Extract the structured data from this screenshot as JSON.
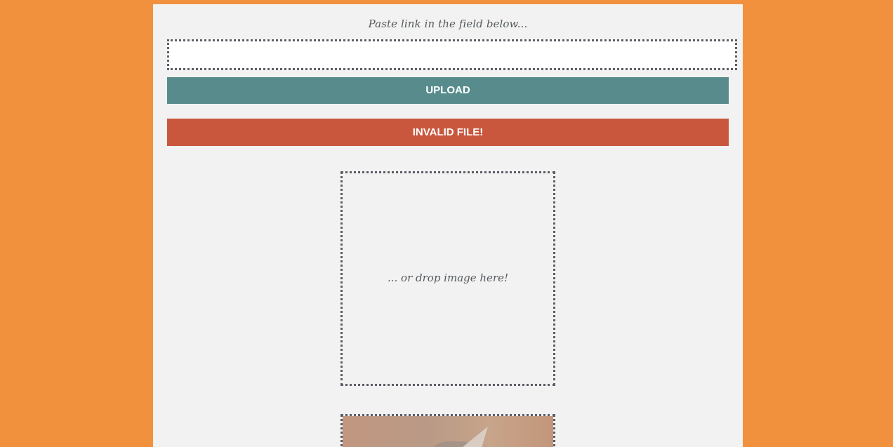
{
  "upload_form": {
    "prompt": "Paste link in the field below...",
    "url_input_value": "",
    "url_input_placeholder": "",
    "upload_label": "UPLOAD",
    "error_message": "INVALID FILE!"
  },
  "dropzone": {
    "text": "... or drop image here!"
  },
  "preview": {
    "image_subject": "cat photo"
  },
  "colors": {
    "page_background": "#f2913d",
    "panel_background": "#f1f2f1",
    "upload_button": "#588c8c",
    "error_bar": "#c8573e",
    "dotted_border": "#5b5d66"
  }
}
